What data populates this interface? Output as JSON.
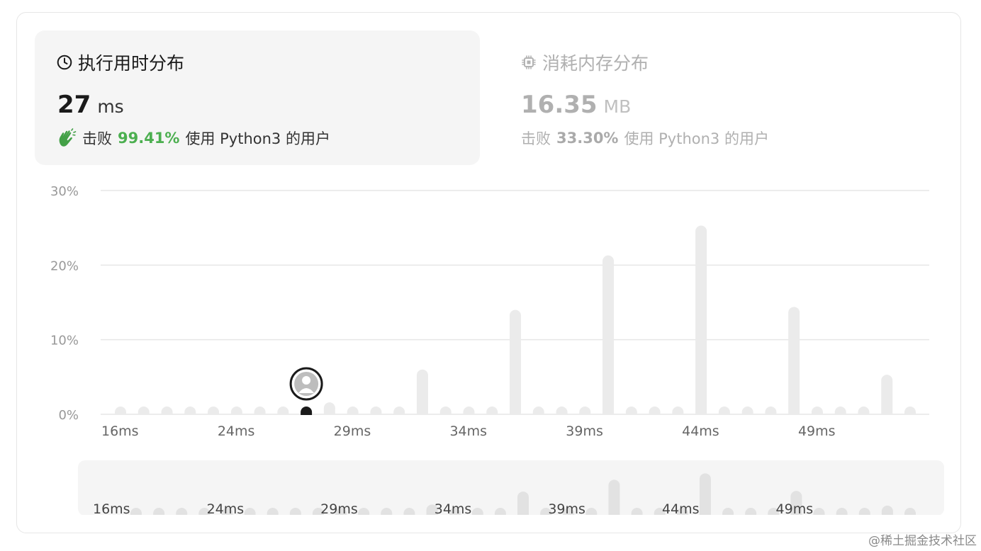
{
  "runtime": {
    "title": "执行用时分布",
    "value": "27",
    "unit": "ms",
    "beat_prefix": "击败",
    "beat_pct": "99.41%",
    "beat_suffix": "使用 Python3 的用户",
    "accent_color": "#4caf50"
  },
  "memory": {
    "title": "消耗内存分布",
    "value": "16.35",
    "unit": "MB",
    "beat_prefix": "击败",
    "beat_pct": "33.30%",
    "beat_suffix": "使用 Python3 的用户"
  },
  "icons": {
    "runtime": "clock-icon",
    "memory": "chip-icon",
    "beat": "clapping-hands-icon",
    "user_marker": "user-avatar-icon"
  },
  "watermark": "@稀土掘金技术社区",
  "chart_data": {
    "type": "bar",
    "title": "",
    "xlabel": "",
    "ylabel": "",
    "ylim": [
      0,
      30
    ],
    "yticks": [
      "30%",
      "20%",
      "10%",
      "0%"
    ],
    "ytick_values": [
      30,
      20,
      10,
      0
    ],
    "xtick_labels": [
      "16ms",
      "24ms",
      "29ms",
      "34ms",
      "39ms",
      "44ms",
      "49ms"
    ],
    "xtick_bar_index": [
      0,
      5,
      10,
      15,
      20,
      25,
      30
    ],
    "values": [
      0.3,
      0.3,
      0.3,
      0.3,
      0.3,
      0.3,
      0.3,
      0.3,
      0.2,
      1.6,
      0.3,
      0.3,
      0.3,
      6.0,
      0.3,
      0.3,
      0.3,
      14.0,
      0.3,
      0.3,
      0.3,
      21.3,
      0.3,
      0.3,
      0.3,
      25.3,
      0.3,
      0.3,
      0.3,
      14.4,
      0.3,
      0.3,
      0.3,
      5.3,
      0.3
    ],
    "highlight_index": 8,
    "grid": true,
    "bar_color": "#ebebeb",
    "highlight_color": "#1a1a1a"
  }
}
